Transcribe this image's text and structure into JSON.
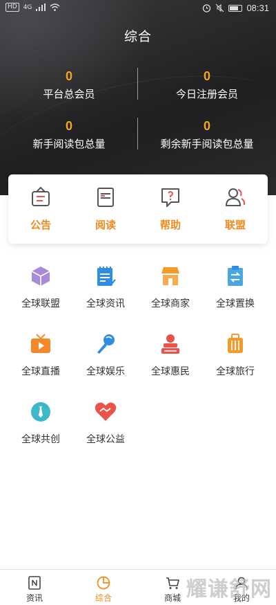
{
  "status_bar": {
    "left_chip": "HD",
    "signal": "4G",
    "time": "08:31"
  },
  "header": {
    "title": "综合",
    "stats": [
      {
        "value": "0",
        "label": "平台总会员"
      },
      {
        "value": "0",
        "label": "今日注册会员"
      },
      {
        "value": "0",
        "label": "新手阅读包总量"
      },
      {
        "value": "0",
        "label": "剩余新手阅读包总量"
      }
    ]
  },
  "quick": [
    {
      "label": "公告",
      "icon": "announcement-icon"
    },
    {
      "label": "阅读",
      "icon": "reading-icon"
    },
    {
      "label": "帮助",
      "icon": "help-icon"
    },
    {
      "label": "联盟",
      "icon": "alliance-icon"
    }
  ],
  "grid": [
    {
      "label": "全球联盟",
      "icon": "cube-icon",
      "color": "#9b7fd4"
    },
    {
      "label": "全球资讯",
      "icon": "notepad-icon",
      "color": "#2f8de4"
    },
    {
      "label": "全球商家",
      "icon": "shop-icon",
      "color": "#f39a2b"
    },
    {
      "label": "全球置换",
      "icon": "exchange-icon",
      "color": "#4aa8e0"
    },
    {
      "label": "全球直播",
      "icon": "live-tv-icon",
      "color": "#f5892a"
    },
    {
      "label": "全球娱乐",
      "icon": "microphone-icon",
      "color": "#2f8de4"
    },
    {
      "label": "全球惠民",
      "icon": "stamp-icon",
      "color": "#e9534a"
    },
    {
      "label": "全球旅行",
      "icon": "luggage-icon",
      "color": "#f39a2b"
    },
    {
      "label": "全球共创",
      "icon": "tie-icon",
      "color": "#3cb8c8"
    },
    {
      "label": "全球公益",
      "icon": "charity-heart-icon",
      "color": "#e9534a"
    }
  ],
  "bottom_nav": [
    {
      "label": "资讯",
      "icon": "news-icon"
    },
    {
      "label": "综合",
      "icon": "overview-icon",
      "active": true
    },
    {
      "label": "商城",
      "icon": "cart-icon"
    },
    {
      "label": "我的",
      "icon": "profile-icon"
    }
  ],
  "watermark": "耀谦舒网",
  "colors": {
    "accent": "#f08a1c",
    "header_bg": "#2a2a2c",
    "stat_value": "#f5a623"
  }
}
